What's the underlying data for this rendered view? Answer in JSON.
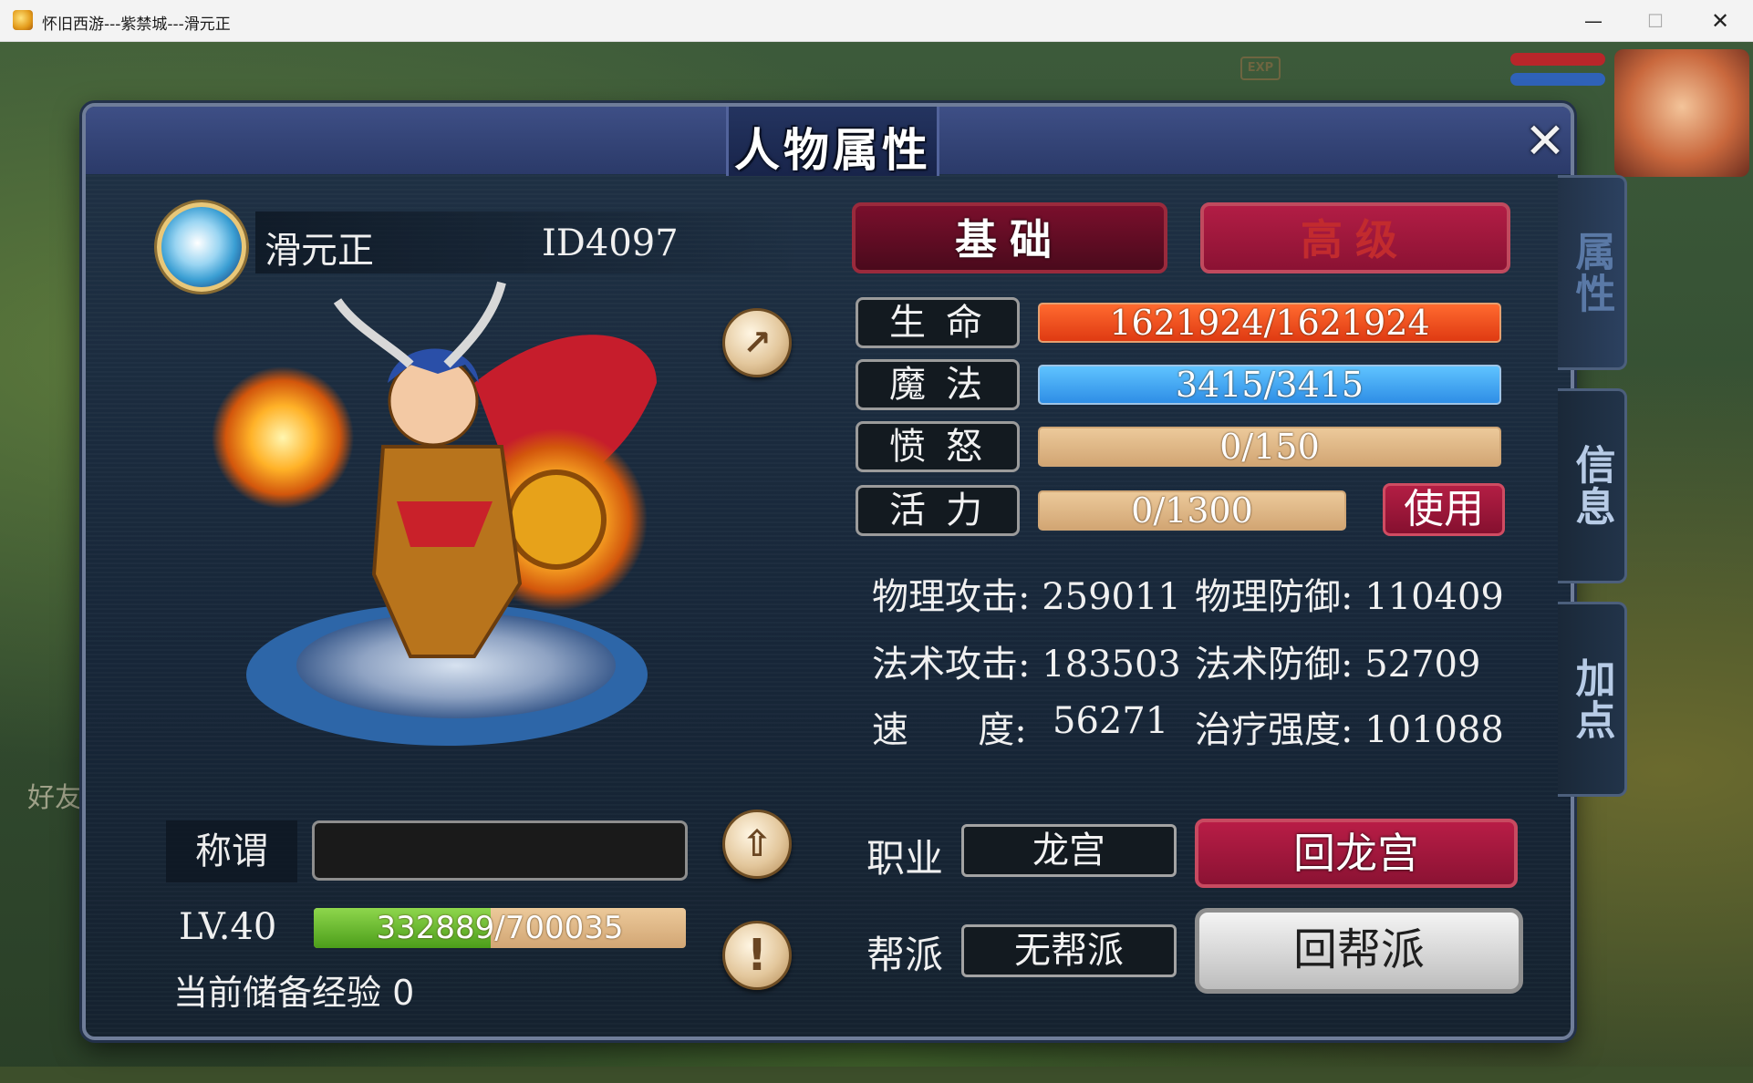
{
  "window": {
    "title": "怀旧西游---紫禁城---滑元正",
    "minimize": "—",
    "maximize": "☐",
    "close": "✕"
  },
  "hud": {
    "exp_badge": "EXP",
    "friend_label": "好友"
  },
  "panel": {
    "title": "人物属性",
    "close_glyph": "✕"
  },
  "side_tabs": [
    {
      "label": "属性",
      "active": true
    },
    {
      "label": "信息",
      "active": false
    },
    {
      "label": "加点",
      "active": false
    }
  ],
  "character": {
    "name": "滑元正",
    "id": "ID4097",
    "title_label": "称谓",
    "title_value": "",
    "level": "LV.40",
    "exp_current": "332889",
    "exp_total": "/700035",
    "exp_fraction": 0.4755,
    "reserve_exp": "当前储备经验  0"
  },
  "tabs": {
    "basic": "基础",
    "advanced": "高级"
  },
  "stats": {
    "hp": {
      "label": "生命",
      "value": "1621924/1621924"
    },
    "mp": {
      "label": "魔法",
      "value": "3415/3415"
    },
    "rage": {
      "label": "愤怒",
      "value": "0/150"
    },
    "vigor": {
      "label": "活力",
      "value": "0/1300"
    },
    "use_button": "使用"
  },
  "attributes": {
    "phys_atk": "物理攻击: 259011",
    "phys_def": "物理防御: 110409",
    "magic_atk": "法术攻击: 183503",
    "magic_def": "法术防御: 52709",
    "speed_label": "速      度:",
    "speed_value": "56271",
    "heal": "治疗强度: 101088"
  },
  "profession": {
    "label": "职业",
    "value": "龙宫",
    "button": "回龙宫"
  },
  "guild": {
    "label": "帮派",
    "value": "无帮派",
    "button": "回帮派"
  },
  "icons": {
    "share": "share-icon",
    "upload": "upload-icon",
    "alert": "exclamation-icon"
  },
  "colors": {
    "hp_bar": "#e8421a",
    "mp_bar": "#3aa0f0",
    "accent_red": "#8b1233",
    "panel_bg": "#1b2a3c"
  }
}
